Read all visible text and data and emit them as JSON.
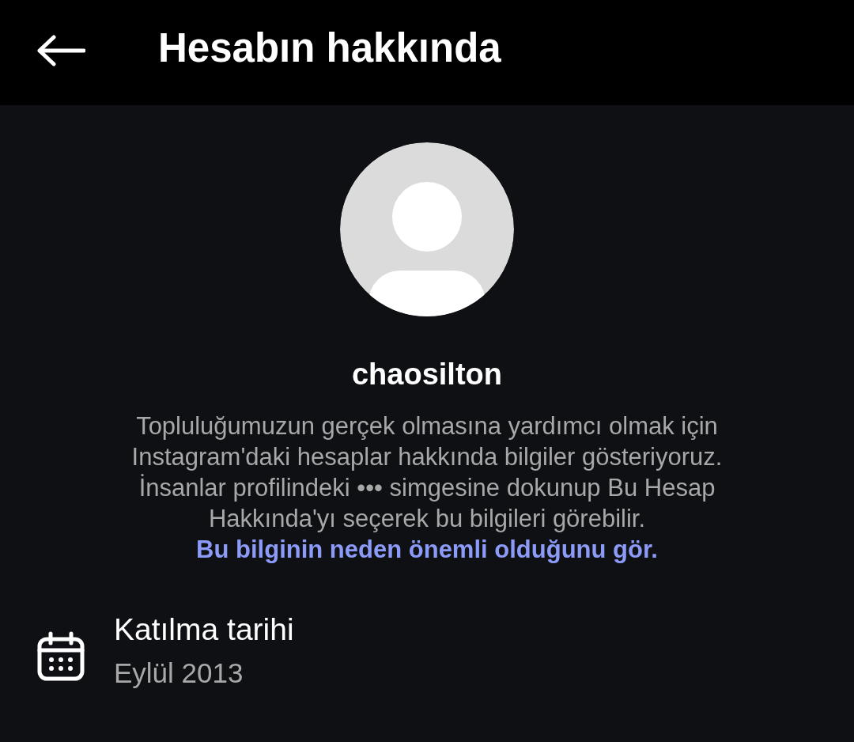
{
  "header": {
    "title": "Hesabın hakkında"
  },
  "profile": {
    "username": "chaosilton"
  },
  "description": {
    "text": "Topluluğumuzun gerçek olmasına yardımcı olmak için Instagram'daki hesaplar hakkında bilgiler gösteriyoruz. İnsanlar profilindeki ••• simgesine dokunup Bu Hesap Hakkında'yı seçerek bu bilgileri görebilir.",
    "link": "Bu bilginin neden önemli olduğunu gör."
  },
  "details": [
    {
      "kind": "date",
      "label": "Katılma tarihi",
      "value": "Eylül 2013"
    }
  ]
}
